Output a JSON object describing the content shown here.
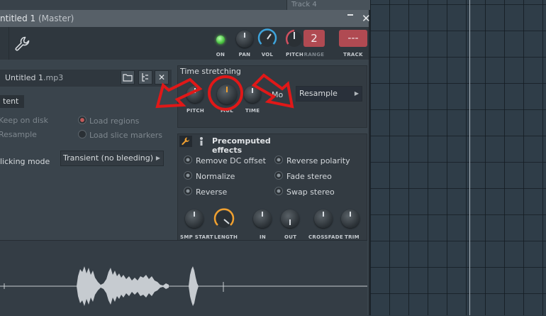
{
  "window": {
    "title": "ntitled 1",
    "title_suffix": "(Master)",
    "close_glyph": "✕"
  },
  "background": {
    "track_label": "Track 4"
  },
  "toolbar": {
    "on_label": "ON",
    "pan_label": "PAN",
    "vol_label": "VOL",
    "pitch_label": "PITCH",
    "range_label": "RANGE",
    "range_value": "2",
    "track_label": "TRACK",
    "track_value": "---"
  },
  "file": {
    "name": "Untitled 1",
    "ext": ".mp3",
    "close_glyph": "✕"
  },
  "content": {
    "section_title": "tent",
    "keep_on_disk": "Keep on disk",
    "resample": "Resample",
    "load_regions": "Load regions",
    "load_slice_markers": "Load slice markers",
    "slicing_mode_label": "licking mode",
    "slicing_mode_value": "Transient (no bleeding)"
  },
  "time_stretching": {
    "title": "Time stretching",
    "pitch_label": "PITCH",
    "mul_label": "MUL",
    "time_label": "TIME",
    "mode_label": "Mo",
    "mode_value": "Resample"
  },
  "precomputed": {
    "title": "Precomputed effects",
    "effects": [
      "Remove DC offset",
      "Normalize",
      "Reverse",
      "Reverse polarity",
      "Fade stereo",
      "Swap stereo"
    ],
    "knobs": [
      "SMP START",
      "LENGTH",
      "IN",
      "OUT",
      "CROSSFADE",
      "TRIM"
    ]
  },
  "colors": {
    "accent_red": "#e01818",
    "range_display": "#b04a52",
    "led_green": "#49c240",
    "knob_ring_blue": "#3ea4dc",
    "knob_ring_orange": "#f0a030"
  }
}
